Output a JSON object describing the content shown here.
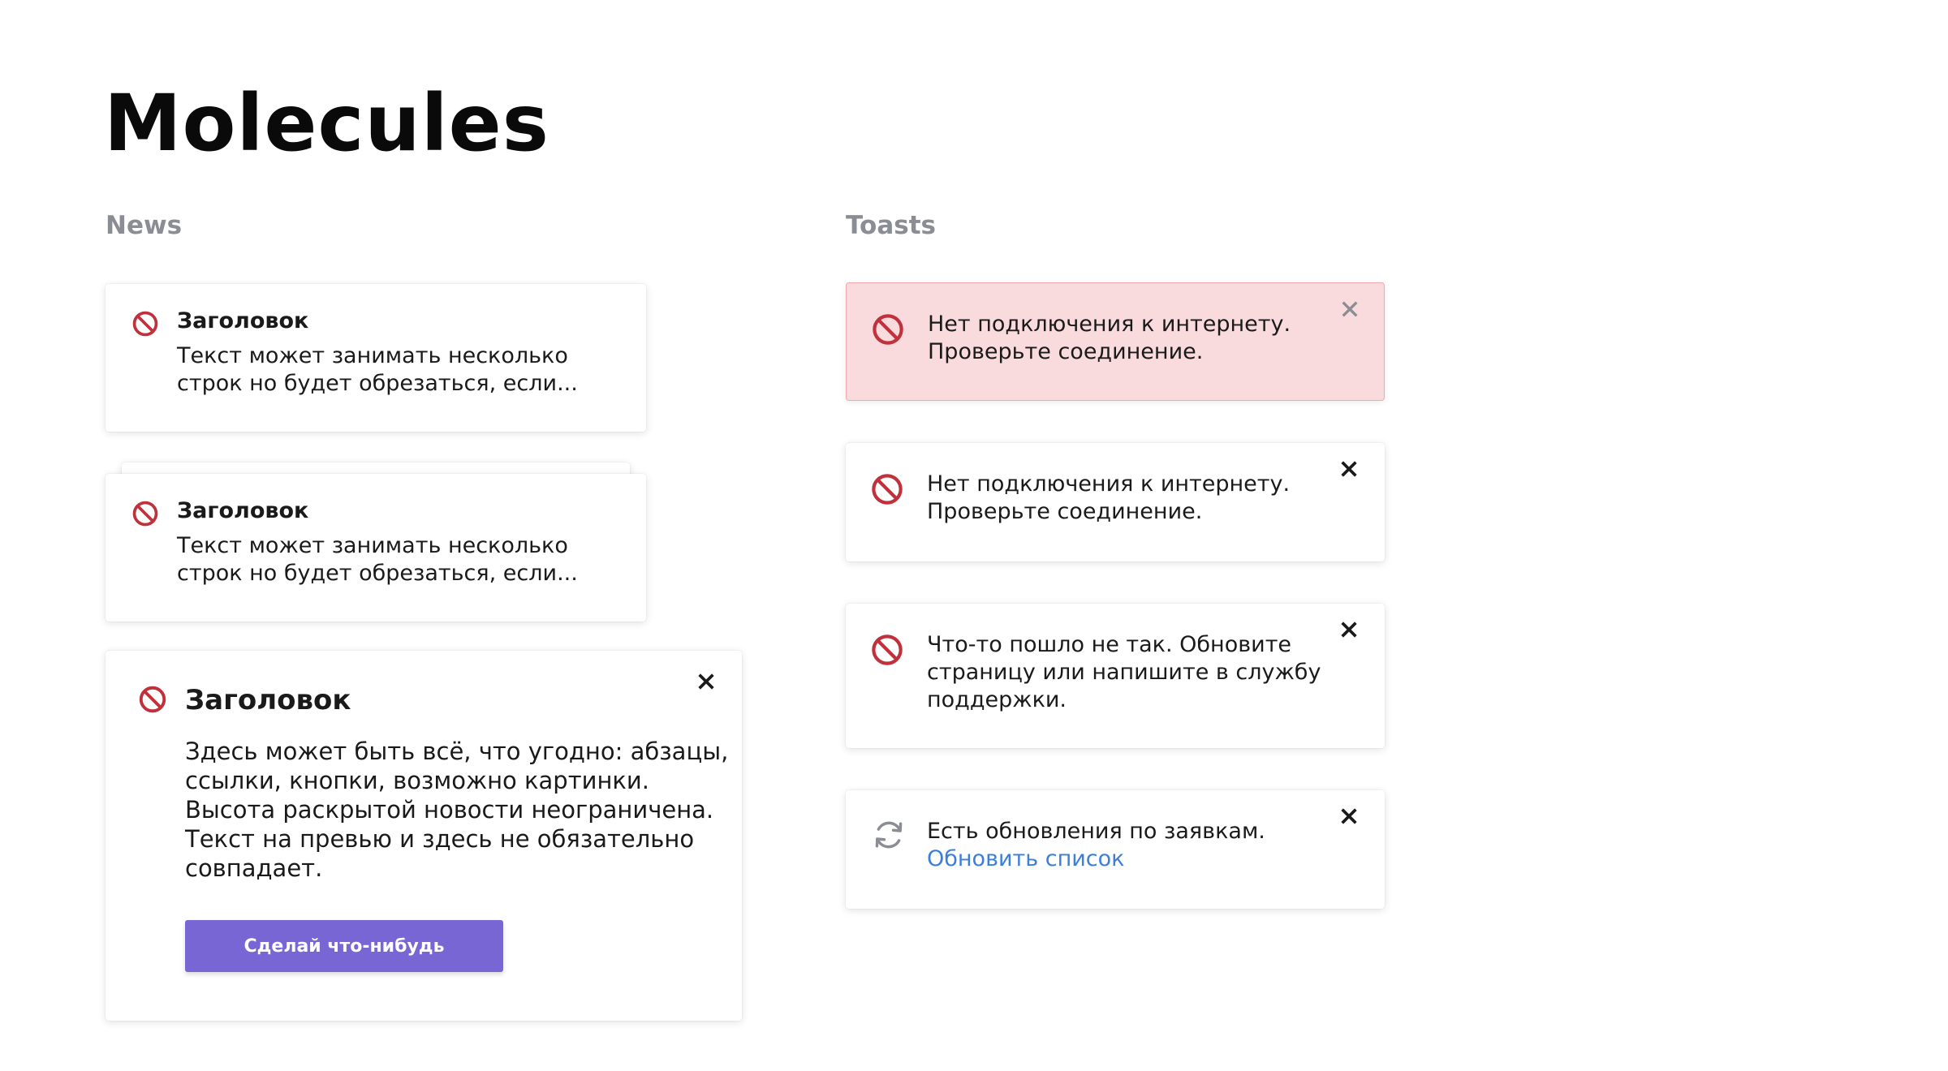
{
  "page": {
    "title": "Molecules"
  },
  "news": {
    "label": "News",
    "items": [
      {
        "title": "Заголовок",
        "text_line1": "Текст может занимать несколько",
        "text_line2": "строк но будет обрезаться, если..."
      },
      {
        "title": "Заголовок",
        "text_line1": "Текст может занимать несколько",
        "text_line2": "строк но будет обрезаться, если..."
      }
    ],
    "expanded": {
      "title": "Заголовок",
      "lines": [
        "Здесь может быть всё, что угодно: абзацы,",
        "ссылки, кнопки, возможно картинки.",
        "Высота раскрытой новости неограничена.",
        "Текст на превью и здесь не обязательно",
        "совпадает."
      ],
      "button_label": "Сделай что-нибудь"
    }
  },
  "toasts": {
    "label": "Toasts",
    "items": [
      {
        "variant": "error-filled",
        "icon": "ban-icon",
        "lines": [
          "Нет подключения к интернету.",
          "Проверьте соединение."
        ]
      },
      {
        "variant": "default",
        "icon": "ban-icon",
        "lines": [
          "Нет подключения к интернету.",
          "Проверьте соединение."
        ]
      },
      {
        "variant": "default",
        "icon": "ban-icon",
        "lines": [
          "Что-то пошло не так. Обновите",
          "страницу или напишите в службу",
          "поддержки."
        ]
      },
      {
        "variant": "default",
        "icon": "refresh-icon",
        "lines": [
          "Есть обновления по заявкам."
        ],
        "link": "Обновить список"
      }
    ]
  },
  "colors": {
    "error_icon": "#c0313c",
    "error_toast_bg": "#fadbdd",
    "error_toast_border": "#f0a9ae",
    "button_bg": "#7866d4",
    "link": "#3b7fdb",
    "section_label": "#8a8d93"
  }
}
